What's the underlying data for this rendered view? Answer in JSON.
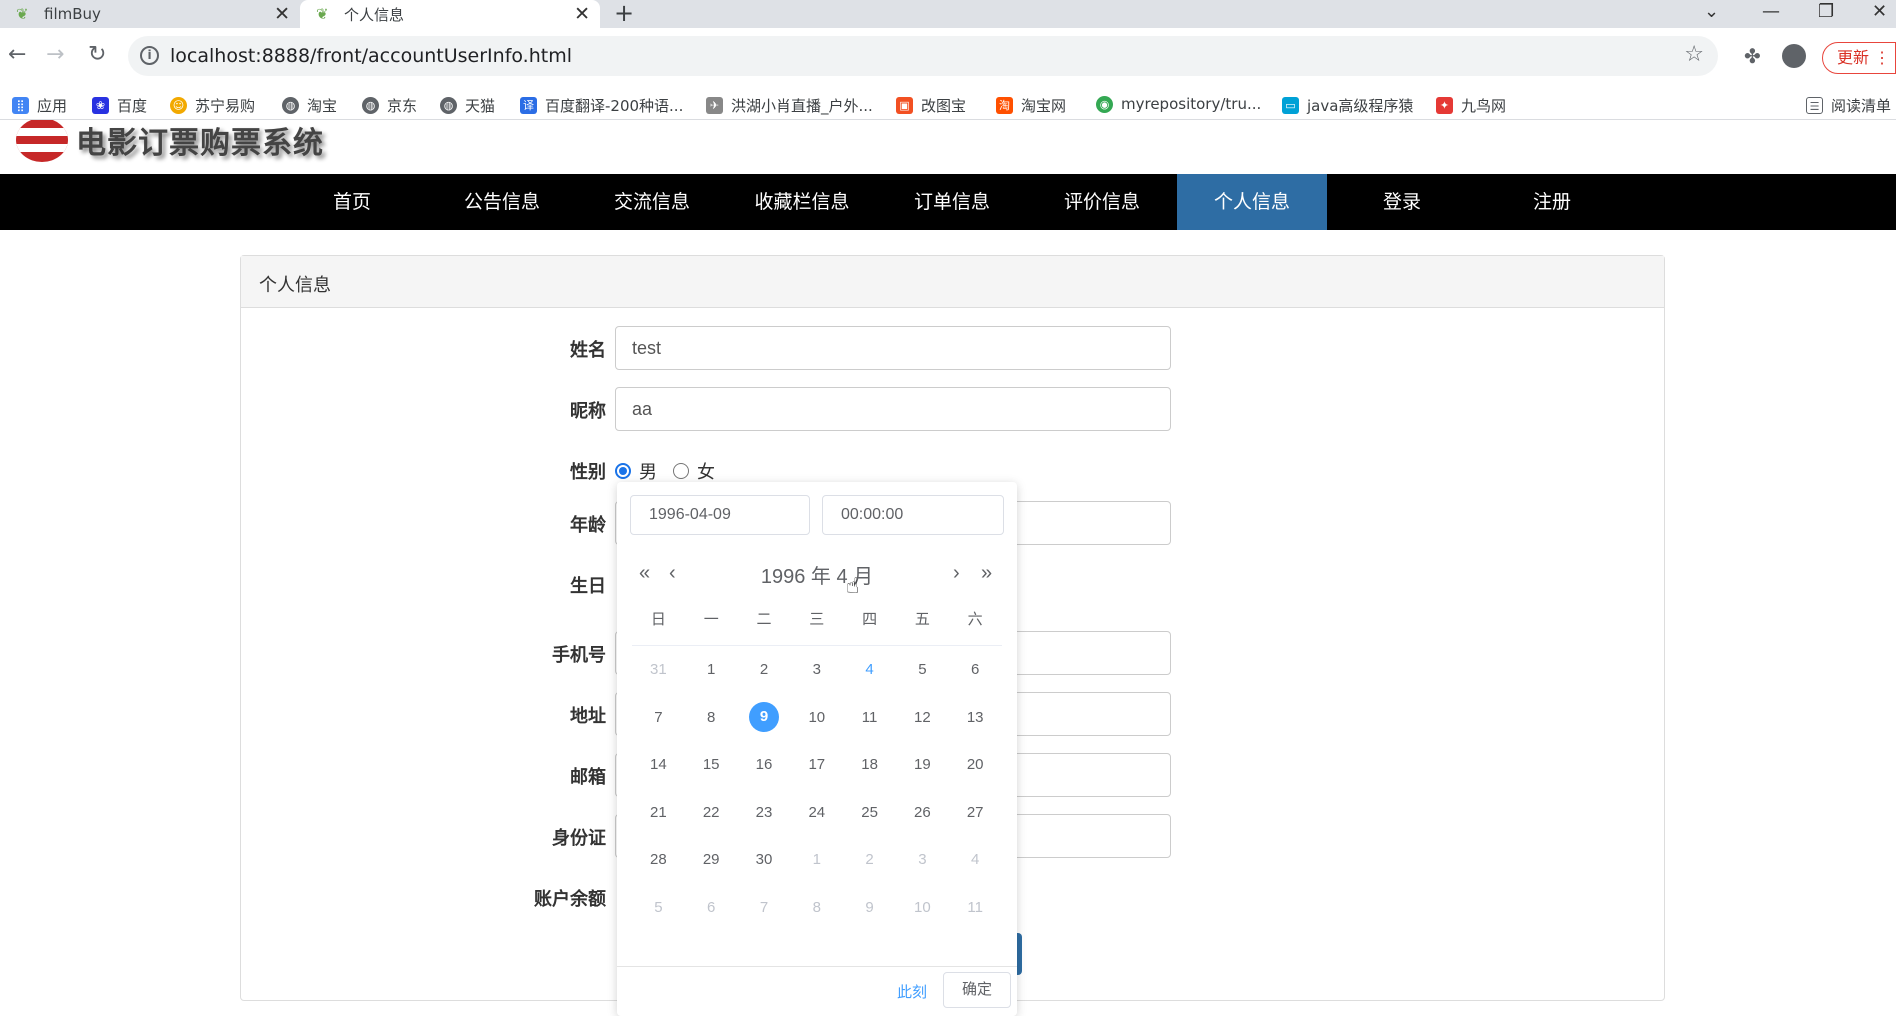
{
  "browser": {
    "tabs": [
      {
        "title": "filmBuy"
      },
      {
        "title": "个人信息"
      }
    ],
    "url": "localhost:8888/front/accountUserInfo.html",
    "update_label": "更新",
    "bookmarks": [
      {
        "label": "应用",
        "icon": "apps-grid-icon",
        "color": "#4285f4"
      },
      {
        "label": "百度",
        "icon": "baidu-paw-icon",
        "color": "#2932e1"
      },
      {
        "label": "苏宁易购",
        "icon": "suning-icon",
        "color": "#f2a900"
      },
      {
        "label": "淘宝",
        "icon": "globe-icon",
        "color": "#5f6368"
      },
      {
        "label": "京东",
        "icon": "globe-icon",
        "color": "#5f6368"
      },
      {
        "label": "天猫",
        "icon": "globe-icon",
        "color": "#5f6368"
      },
      {
        "label": "百度翻译-200种语...",
        "icon": "translate-icon",
        "color": "#2b6de5"
      },
      {
        "label": "洪湖小肖直播_户外...",
        "icon": "bird-icon",
        "color": "#888888"
      },
      {
        "label": "改图宝",
        "icon": "image-edit-icon",
        "color": "#f25022"
      },
      {
        "label": "淘宝网",
        "icon": "taobao-icon",
        "color": "#ff5000"
      },
      {
        "label": "myrepository/tru...",
        "icon": "chrome-icon",
        "color": "#34a853"
      },
      {
        "label": "java高级程序猿",
        "icon": "bilibili-icon",
        "color": "#00a1d6"
      },
      {
        "label": "九鸟网",
        "icon": "bird-red-icon",
        "color": "#e53935"
      }
    ],
    "reading_list": "阅读清单"
  },
  "site": {
    "logo_text": "电影订票购票系统",
    "nav": [
      {
        "label": "首页",
        "active": false
      },
      {
        "label": "公告信息",
        "active": false
      },
      {
        "label": "交流信息",
        "active": false
      },
      {
        "label": "收藏栏信息",
        "active": false
      },
      {
        "label": "订单信息",
        "active": false
      },
      {
        "label": "评价信息",
        "active": false
      },
      {
        "label": "个人信息",
        "active": true
      },
      {
        "label": "登录",
        "active": false
      },
      {
        "label": "注册",
        "active": false
      }
    ]
  },
  "form": {
    "panel_title": "个人信息",
    "name_label": "姓名",
    "name_value": "test",
    "nickname_label": "昵称",
    "nickname_value": "aa",
    "gender_label": "性别",
    "gender_male": "男",
    "gender_female": "女",
    "gender_selected": "男",
    "age_label": "年龄",
    "birthday_label": "生日",
    "phone_label": "手机号",
    "address_label": "地址",
    "email_label": "邮箱",
    "idcard_label": "身份证",
    "balance_label": "账户余额"
  },
  "datepicker": {
    "date_input": "1996-04-09",
    "time_input": "00:00:00",
    "year_label": "1996 年",
    "month_label": "4 月",
    "weekdays": [
      "日",
      "一",
      "二",
      "三",
      "四",
      "五",
      "六"
    ],
    "weeks": [
      [
        {
          "d": "31",
          "s": "dim"
        },
        {
          "d": "1"
        },
        {
          "d": "2"
        },
        {
          "d": "3"
        },
        {
          "d": "4",
          "s": "today"
        },
        {
          "d": "5"
        },
        {
          "d": "6"
        }
      ],
      [
        {
          "d": "7"
        },
        {
          "d": "8"
        },
        {
          "d": "9",
          "s": "sel"
        },
        {
          "d": "10"
        },
        {
          "d": "11"
        },
        {
          "d": "12"
        },
        {
          "d": "13"
        }
      ],
      [
        {
          "d": "14"
        },
        {
          "d": "15"
        },
        {
          "d": "16"
        },
        {
          "d": "17"
        },
        {
          "d": "18"
        },
        {
          "d": "19"
        },
        {
          "d": "20"
        }
      ],
      [
        {
          "d": "21"
        },
        {
          "d": "22"
        },
        {
          "d": "23"
        },
        {
          "d": "24"
        },
        {
          "d": "25"
        },
        {
          "d": "26"
        },
        {
          "d": "27"
        }
      ],
      [
        {
          "d": "28"
        },
        {
          "d": "29"
        },
        {
          "d": "30"
        },
        {
          "d": "1",
          "s": "dim"
        },
        {
          "d": "2",
          "s": "dim"
        },
        {
          "d": "3",
          "s": "dim"
        },
        {
          "d": "4",
          "s": "dim"
        }
      ],
      [
        {
          "d": "5",
          "s": "dim"
        },
        {
          "d": "6",
          "s": "dim"
        },
        {
          "d": "7",
          "s": "dim"
        },
        {
          "d": "8",
          "s": "dim"
        },
        {
          "d": "9",
          "s": "dim"
        },
        {
          "d": "10",
          "s": "dim"
        },
        {
          "d": "11",
          "s": "dim"
        }
      ]
    ],
    "now_label": "此刻",
    "confirm_label": "确定"
  },
  "colors": {
    "nav_active": "#2e6da4",
    "picker_accent": "#409eff"
  }
}
